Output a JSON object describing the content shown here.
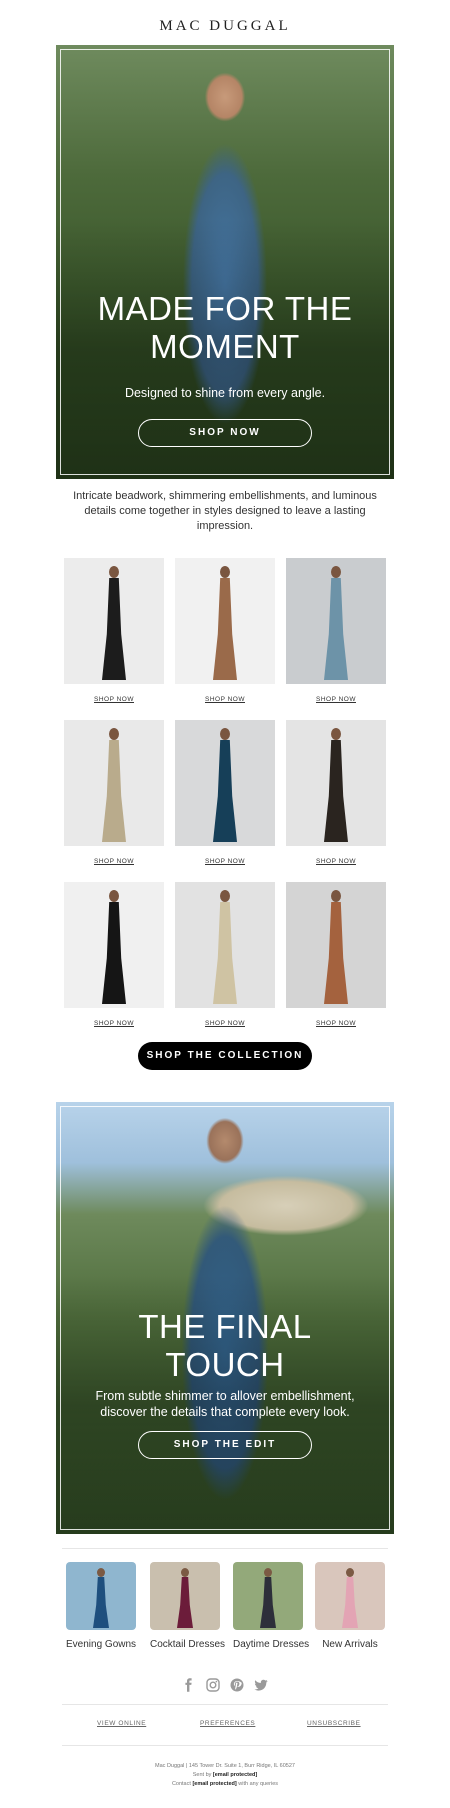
{
  "brand": {
    "logo": "MAC DUGGAL"
  },
  "hero1": {
    "title_line1": "MADE FOR THE",
    "title_line2": "MOMENT",
    "subtitle": "Designed to shine from every angle.",
    "button": "SHOP NOW"
  },
  "intro": {
    "text": "Intricate beadwork, shimmering embellishments, and luminous details come together in styles designed to leave a lasting impression."
  },
  "products": [
    {
      "link": "SHOP NOW",
      "dress_color": "#1c1c1c",
      "bg": "#ececec"
    },
    {
      "link": "SHOP NOW",
      "dress_color": "#9a6a4a",
      "bg": "#f1f1f1"
    },
    {
      "link": "SHOP NOW",
      "dress_color": "#6d93a8",
      "bg": "#c9cccf"
    },
    {
      "link": "SHOP NOW",
      "dress_color": "#b9ab8c",
      "bg": "#e9e9e9"
    },
    {
      "link": "SHOP NOW",
      "dress_color": "#163f58",
      "bg": "#d8d9da"
    },
    {
      "link": "SHOP NOW",
      "dress_color": "#2a241f",
      "bg": "#e4e4e4"
    },
    {
      "link": "SHOP NOW",
      "dress_color": "#151515",
      "bg": "#f0f0f0"
    },
    {
      "link": "SHOP NOW",
      "dress_color": "#cfc3a3",
      "bg": "#e2e2e2"
    },
    {
      "link": "SHOP NOW",
      "dress_color": "#a4623e",
      "bg": "#d4d4d4"
    }
  ],
  "collection_button": "SHOP THE COLLECTION",
  "hero2": {
    "title_line1": "THE FINAL",
    "title_line2": "TOUCH",
    "subtitle_line1": "From subtle shimmer to allover embellishment,",
    "subtitle_line2": "discover the details that complete every look.",
    "button": "SHOP THE EDIT"
  },
  "categories": [
    {
      "label": "Evening Gowns",
      "dress_color": "#1e4f7e",
      "bg": "#8fb6cf"
    },
    {
      "label": "Cocktail Dresses",
      "dress_color": "#6c1c3a",
      "bg": "#c9bfae"
    },
    {
      "label": "Daytime Dresses",
      "dress_color": "#2d2f3a",
      "bg": "#93a97a"
    },
    {
      "label": "New Arrivals",
      "dress_color": "#e3a4b4",
      "bg": "#d9c6bc"
    }
  ],
  "social_icons": [
    "facebook-icon",
    "instagram-icon",
    "pinterest-icon",
    "twitter-icon"
  ],
  "footer": {
    "view_online": "VIEW ONLINE",
    "preferences": "PREFERENCES",
    "unsubscribe": "UNSUBSCRIBE",
    "address": "Mac Duggal | 145 Tower Dr. Suite 1, Burr Ridge, IL 60527",
    "sent_by_prefix": "Sent by",
    "sent_by_email": "[email protected]",
    "contact_prefix": "Contact",
    "contact_email": "[email protected]",
    "contact_suffix": "with any queries"
  }
}
